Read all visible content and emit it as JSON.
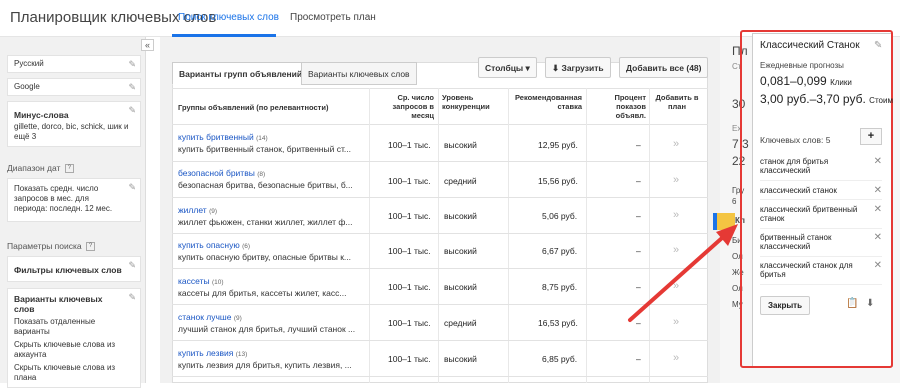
{
  "header": {
    "title": "Планировщик ключевых слов",
    "tabs": [
      "Поиск ключевых слов",
      "Просмотреть план"
    ]
  },
  "sidebar": {
    "collapse_icon": "«",
    "language": "Русский",
    "network": "Google",
    "negatives_title": "Минус-слова",
    "negatives_value": "gillette, dorco, bic, schick, шик и ещё 3",
    "date_range_heading": "Диапазон дат",
    "date_range_value": "Показать средн. число запросов в мес. для периода: последн. 12 мес.",
    "search_params_heading": "Параметры поиска",
    "keyword_filters": "Фильтры ключевых слов",
    "ad_group_options_title": "Варианты ключевых слов",
    "ad_group_options_lines": [
      "Показать отдаленные варианты",
      "Скрыть ключевые слова из аккаунта",
      "Скрыть ключевые слова из плана"
    ],
    "help_glyph": "?"
  },
  "content": {
    "tabs": [
      "Варианты групп объявлений",
      "Варианты ключевых слов"
    ],
    "buttons": {
      "columns": "Столбцы ▾",
      "download": "Загрузить",
      "add_all": "Добавить все (48)"
    },
    "columns": [
      "Группы объявлений (по релевантности)",
      "Ср. число запросов в месяц",
      "Уровень конкуренции",
      "Рекомендованная ставка",
      "Процент показов объявл.",
      "Добавить в план"
    ],
    "rows": [
      {
        "name": "купить бритвенный",
        "count": "(14)",
        "keywords": "купить бритвенный станок, бритвенный ст...",
        "searches": "100–1 тыс.",
        "competition": "высокий",
        "bid": "12,95 руб.",
        "share": "–"
      },
      {
        "name": "безопасной бритвы",
        "count": "(8)",
        "keywords": "безопасная бритва, безопасные бритвы, б...",
        "searches": "100–1 тыс.",
        "competition": "средний",
        "bid": "15,56 руб.",
        "share": "–"
      },
      {
        "name": "жиллет",
        "count": "(9)",
        "keywords": "жиллет фьюжен, станки жиллет, жиллет ф...",
        "searches": "100–1 тыс.",
        "competition": "высокий",
        "bid": "5,06 руб.",
        "share": "–"
      },
      {
        "name": "купить опасную",
        "count": "(6)",
        "keywords": "купить опасную бритву, опасные бритвы к...",
        "searches": "100–1 тыс.",
        "competition": "высокий",
        "bid": "6,67 руб.",
        "share": "–"
      },
      {
        "name": "кассеты",
        "count": "(10)",
        "keywords": "кассеты для бритья, кассеты жилет, касс...",
        "searches": "100–1 тыс.",
        "competition": "высокий",
        "bid": "8,75 руб.",
        "share": "–"
      },
      {
        "name": "станок лучше",
        "count": "(9)",
        "keywords": "лучший станок для бритья, лучший станок ...",
        "searches": "100–1 тыс.",
        "competition": "средний",
        "bid": "16,53 руб.",
        "share": "–"
      },
      {
        "name": "купить лезвия",
        "count": "(13)",
        "keywords": "купить лезвия для бритья, купить лезвия, ...",
        "searches": "100–1 тыс.",
        "competition": "высокий",
        "bid": "6,85 руб.",
        "share": "–"
      }
    ],
    "add_glyph": "»"
  },
  "behind_panel": [
    "Пл",
    "Ст",
    "30",
    "Ех",
    "7 3",
    "22",
    "Гру",
    "6",
    "Кл",
    "Би",
    "Ол",
    "Же",
    "Ол",
    "Му"
  ],
  "panel": {
    "title": "Классический Станок",
    "forecast_label": "Ежедневные прогнозы",
    "clicks_value": "0,081–0,099",
    "clicks_unit": "Клики",
    "cost_value": "3,00 руб.–3,70 руб.",
    "cost_unit": "Стоим",
    "keywords_label": "Ключевых слов: 5",
    "add_glyph": "+",
    "keywords": [
      "станок для бритья классический",
      "классический станок",
      "классический бритвенный станок",
      "бритвенный станок классический",
      "классический станок для бритья"
    ],
    "remove_glyph": "✕",
    "close_label": "Закрыть"
  },
  "colors": {
    "accent": "#1a73e8",
    "link": "#1a56c4",
    "annotation": "#e53935",
    "highlight": "#f4c542"
  }
}
